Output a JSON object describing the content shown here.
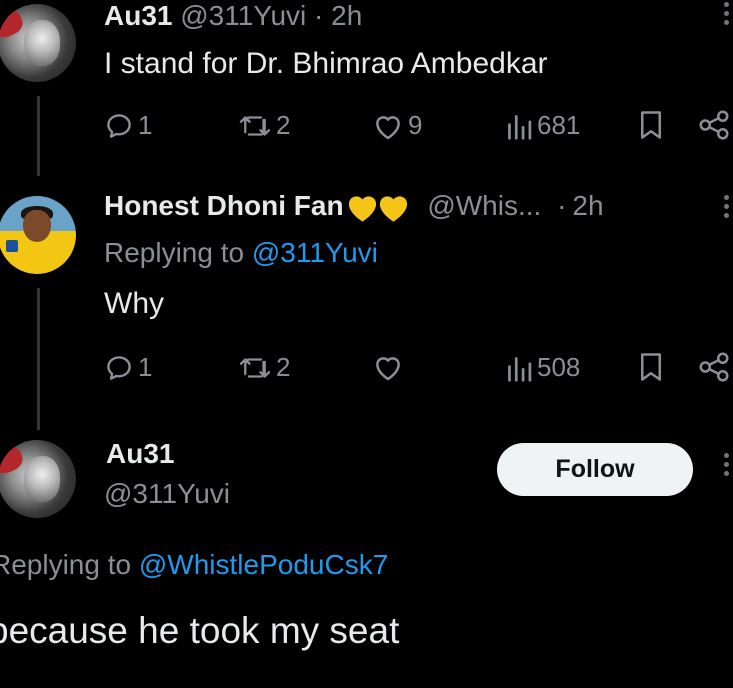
{
  "tweet1": {
    "display_name": "Au31",
    "handle": "@311Yuvi",
    "separator": "·",
    "time": "2h",
    "text": "I stand for Dr. Bhimrao Ambedkar",
    "replies": "1",
    "retweets": "2",
    "likes": "9",
    "views": "681"
  },
  "tweet2": {
    "display_name": "Honest Dhoni Fan",
    "handle": "@Whis...",
    "separator": "·",
    "time": "2h",
    "replying_prefix": "Replying to",
    "replying_handle": "@311Yuvi",
    "text": "Why",
    "replies": "1",
    "retweets": "2",
    "likes": "",
    "views": "508"
  },
  "tweet3": {
    "display_name": "Au31",
    "handle": "@311Yuvi",
    "follow_label": "Follow",
    "replying_prefix": "Replying to",
    "replying_handle": "@WhistlePoduCsk7",
    "text": "because he took my seat"
  },
  "colors": {
    "background": "#000000",
    "text": "#e7e9ea",
    "muted": "#8b8f94",
    "link": "#1d9bf0",
    "follow_bg": "#eff3f4",
    "heart_emoji": "#f5c518"
  }
}
